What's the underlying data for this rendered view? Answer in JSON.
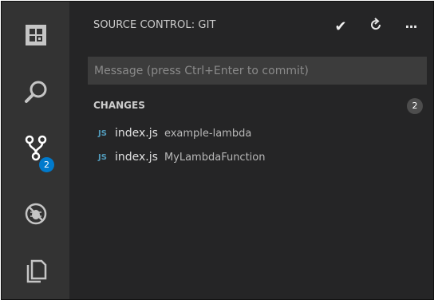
{
  "activity_bar": {
    "items": [
      {
        "icon": "explorer-icon"
      },
      {
        "icon": "search-icon"
      },
      {
        "icon": "source-control-icon",
        "badge": "2"
      },
      {
        "icon": "debug-icon"
      },
      {
        "icon": "extensions-icon"
      }
    ],
    "badge_color": "#007acc"
  },
  "sidebar": {
    "title": "SOURCE CONTROL: GIT",
    "actions": [
      {
        "icon": "checkmark-icon",
        "glyph": "✔"
      },
      {
        "icon": "refresh-icon"
      },
      {
        "icon": "more-icon",
        "glyph": "···"
      }
    ],
    "message_input": {
      "value": "",
      "placeholder": "Message (press Ctrl+Enter to commit)"
    },
    "changes": {
      "label": "CHANGES",
      "count": "2",
      "files": [
        {
          "icon_label": "JS",
          "name": "index.js",
          "folder": "example-lambda"
        },
        {
          "icon_label": "JS",
          "name": "index.js",
          "folder": "MyLambdaFunction"
        }
      ]
    }
  },
  "colors": {
    "background": "#252526",
    "activity_bar": "#333333",
    "input": "#3c3c3c",
    "js_icon": "#519aba"
  }
}
